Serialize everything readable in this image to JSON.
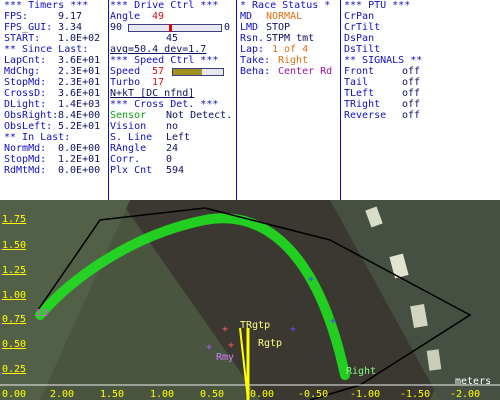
{
  "timers": {
    "header": "*** Timers ***",
    "rows": [
      {
        "label": "FPS:",
        "value": "9.17"
      },
      {
        "label": "FPS_GUI:",
        "value": "3.34"
      },
      {
        "label": "START:",
        "value": "1.0E+02"
      }
    ],
    "since_last_header": "** Since Last:",
    "since_rows": [
      {
        "label": "LapCnt:",
        "value": "3.6E+01"
      },
      {
        "label": "MdChg:",
        "value": "2.3E+01"
      },
      {
        "label": "StopMd:",
        "value": "2.3E+01"
      },
      {
        "label": "CrossD:",
        "value": "3.6E+01"
      },
      {
        "label": "DLight:",
        "value": "1.4E+03"
      },
      {
        "label": "ObsRight:",
        "value": "8.4E+00"
      },
      {
        "label": "ObsLeft:",
        "value": "5.2E+01"
      }
    ],
    "in_last_header": "** In Last:",
    "in_rows": [
      {
        "label": "NormMd:",
        "value": "0.0E+00"
      },
      {
        "label": "StopMd:",
        "value": "1.2E+01"
      },
      {
        "label": "RdMtMd:",
        "value": "0.0E+00"
      }
    ]
  },
  "drive": {
    "header": "*** Drive Ctrl ***",
    "angle_label": "Angle",
    "angle_value": "49",
    "bar_min": "90",
    "bar_max": "0",
    "bar_mid": "45",
    "avg_text": "avg=50.4  dev=1.7",
    "speed_header": "*** Speed Ctrl ***",
    "speed_label": "Speed",
    "speed_value": "57",
    "speed_fill_fraction": 0.57,
    "turbo_label": "Turbo",
    "turbo_value": "17",
    "nkt_text": "N+kT [DC nfnd]",
    "cross_header": "*** Cross Det. ***",
    "cross_rows": [
      {
        "label": "Sensor",
        "value": "Not Detect."
      },
      {
        "label": "Vision",
        "value": "no"
      },
      {
        "label": "S. Line",
        "value": "Left"
      },
      {
        "label": "RAngle",
        "value": "24"
      },
      {
        "label": "Corr.",
        "value": "0"
      },
      {
        "label": "Plx Cnt",
        "value": "594"
      }
    ]
  },
  "race": {
    "header": "* Race Status *",
    "rows": [
      {
        "label": "MD",
        "value": "NORMAL"
      },
      {
        "label": "LMD",
        "value": "STOP"
      },
      {
        "label": "Rsn.",
        "value": "STPM tmt"
      },
      {
        "label": "Lap:",
        "value": "1 of 4"
      },
      {
        "label": "Take:",
        "value": "Right"
      },
      {
        "label": "Beha:",
        "value": "Center Rd"
      }
    ]
  },
  "ptu": {
    "header": "*** PTU ***",
    "items": [
      "CrPan",
      "CrTilt",
      "DsPan",
      "DsTilt"
    ],
    "signals_header": "** SIGNALS **",
    "signals": [
      {
        "label": "Front",
        "value": "off"
      },
      {
        "label": "Tail",
        "value": "off"
      },
      {
        "label": "TLeft",
        "value": "off"
      },
      {
        "label": "TRight",
        "value": "off"
      },
      {
        "label": "Reverse",
        "value": "off"
      }
    ]
  },
  "camera": {
    "y_ticks": [
      "1.75",
      "1.50",
      "1.25",
      "1.00",
      "0.75",
      "0.50",
      "0.25"
    ],
    "x_ticks": [
      "0.00",
      "2.00",
      "1.50",
      "1.00",
      "0.50",
      "0.00",
      "-0.50",
      "-1.00",
      "-1.50",
      "-2.00"
    ],
    "units": "meters",
    "markers": {
      "trgtp": "TRgtp",
      "rgtp": "Rgtp",
      "rmy": "Rmy",
      "right": "Right",
      "pos_left": "13"
    }
  }
}
